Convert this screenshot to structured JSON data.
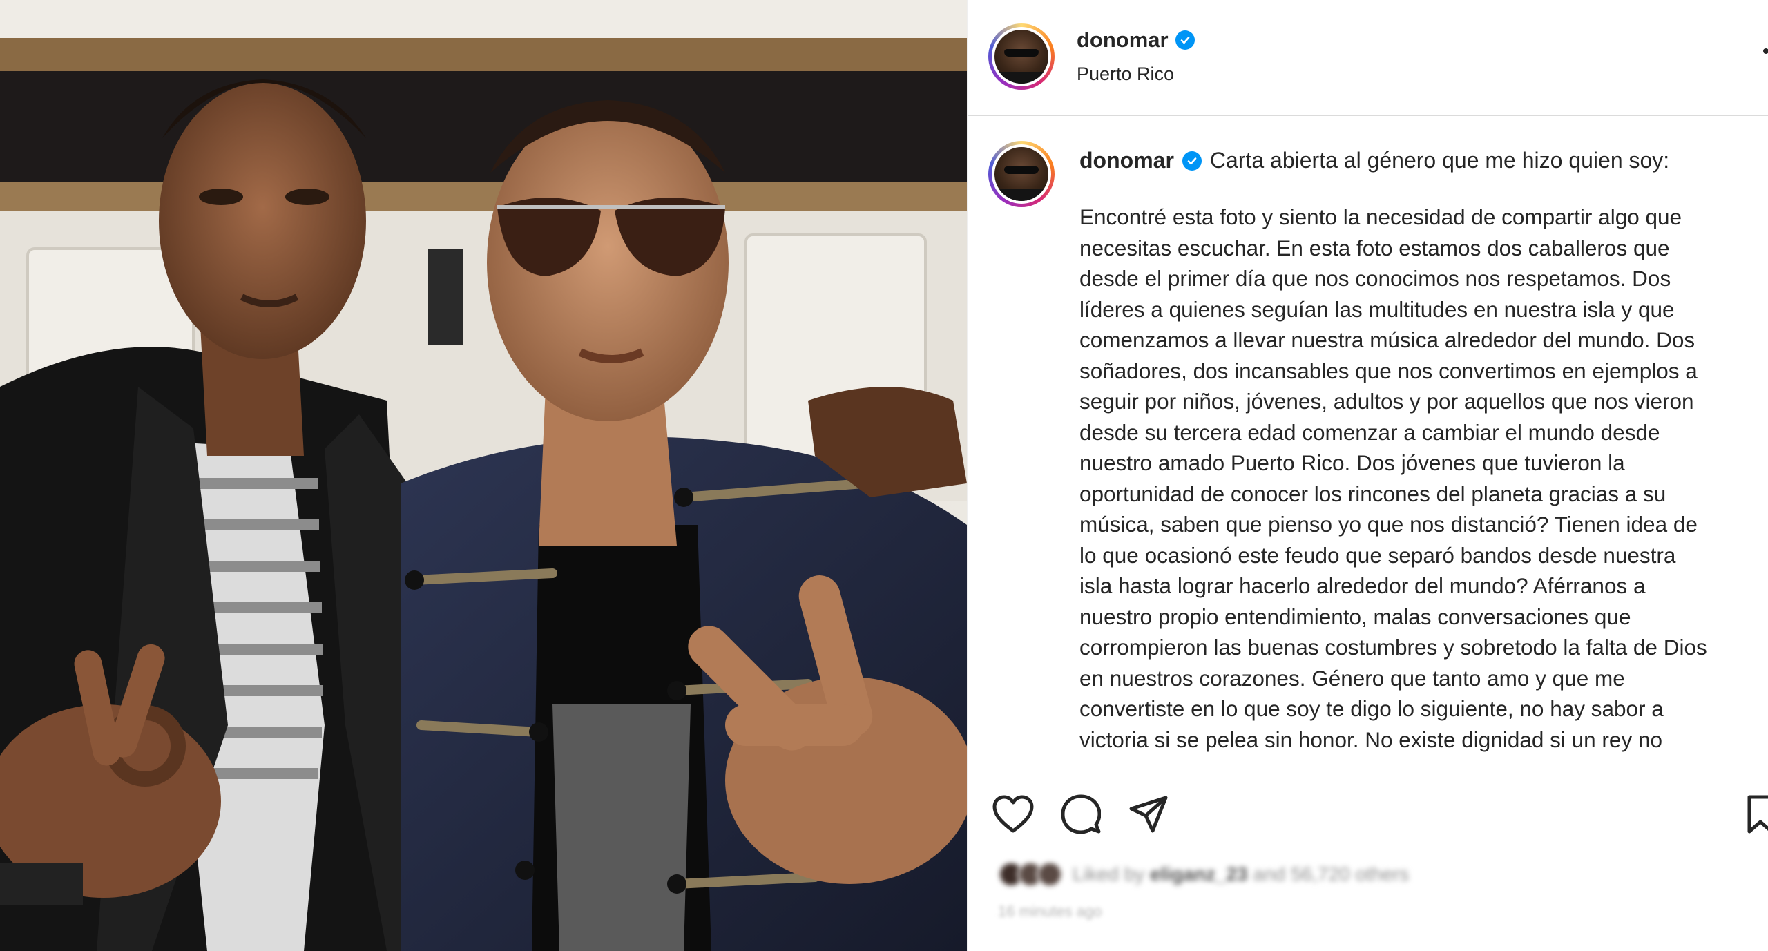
{
  "post": {
    "header": {
      "username": "donomar",
      "location": "Puerto Rico"
    },
    "caption": {
      "username": "donomar",
      "title": "Carta abierta al género que me hizo quien soy:",
      "lines": [
        "Encontré esta foto y siento la necesidad de compartir algo que",
        "necesitas escuchar. En esta foto estamos dos caballeros que",
        "desde el primer día que nos conocimos nos respetamos. Dos",
        "líderes a quienes seguían las multitudes en nuestra isla y que",
        "comenzamos a llevar nuestra música alrededor del mundo. Dos",
        "soñadores, dos incansables que nos convertimos en ejemplos a",
        "seguir por niños, jóvenes, adultos y por aquellos que nos vieron",
        "desde su tercera edad comenzar a cambiar el mundo desde",
        "nuestro amado Puerto Rico. Dos jóvenes que tuvieron la",
        "oportunidad de conocer los rincones del planeta gracias a su",
        "música, saben que pienso yo que nos distanció? Tienen idea de",
        "lo que ocasionó este feudo que separó bandos desde nuestra",
        "isla hasta lograr hacerlo alrededor del mundo? Aférranos a",
        "nuestro propio entendimiento, malas conversaciones que",
        "corrompieron las buenas costumbres y sobretodo la falta de Dios",
        "en nuestros corazones. Género que tanto amo y que me",
        "convertiste en lo que soy te digo lo siguiente, no hay sabor a",
        "victoria si se pelea sin honor. No existe dignidad si un rey no"
      ]
    },
    "likes": {
      "text_prefix": "Liked by",
      "text_user": "eliganz_23",
      "text_suffix": "and 56,720 others"
    },
    "timestamp": "16 minutes ago"
  },
  "icons": {
    "verified": "verified-badge-icon",
    "like": "heart-icon",
    "comment": "comment-bubble-icon",
    "share": "paper-plane-icon",
    "save": "bookmark-icon",
    "more": "more-options-icon"
  },
  "colors": {
    "verified": "#0095f6",
    "text": "#262626",
    "divider": "#dbdbdb"
  }
}
